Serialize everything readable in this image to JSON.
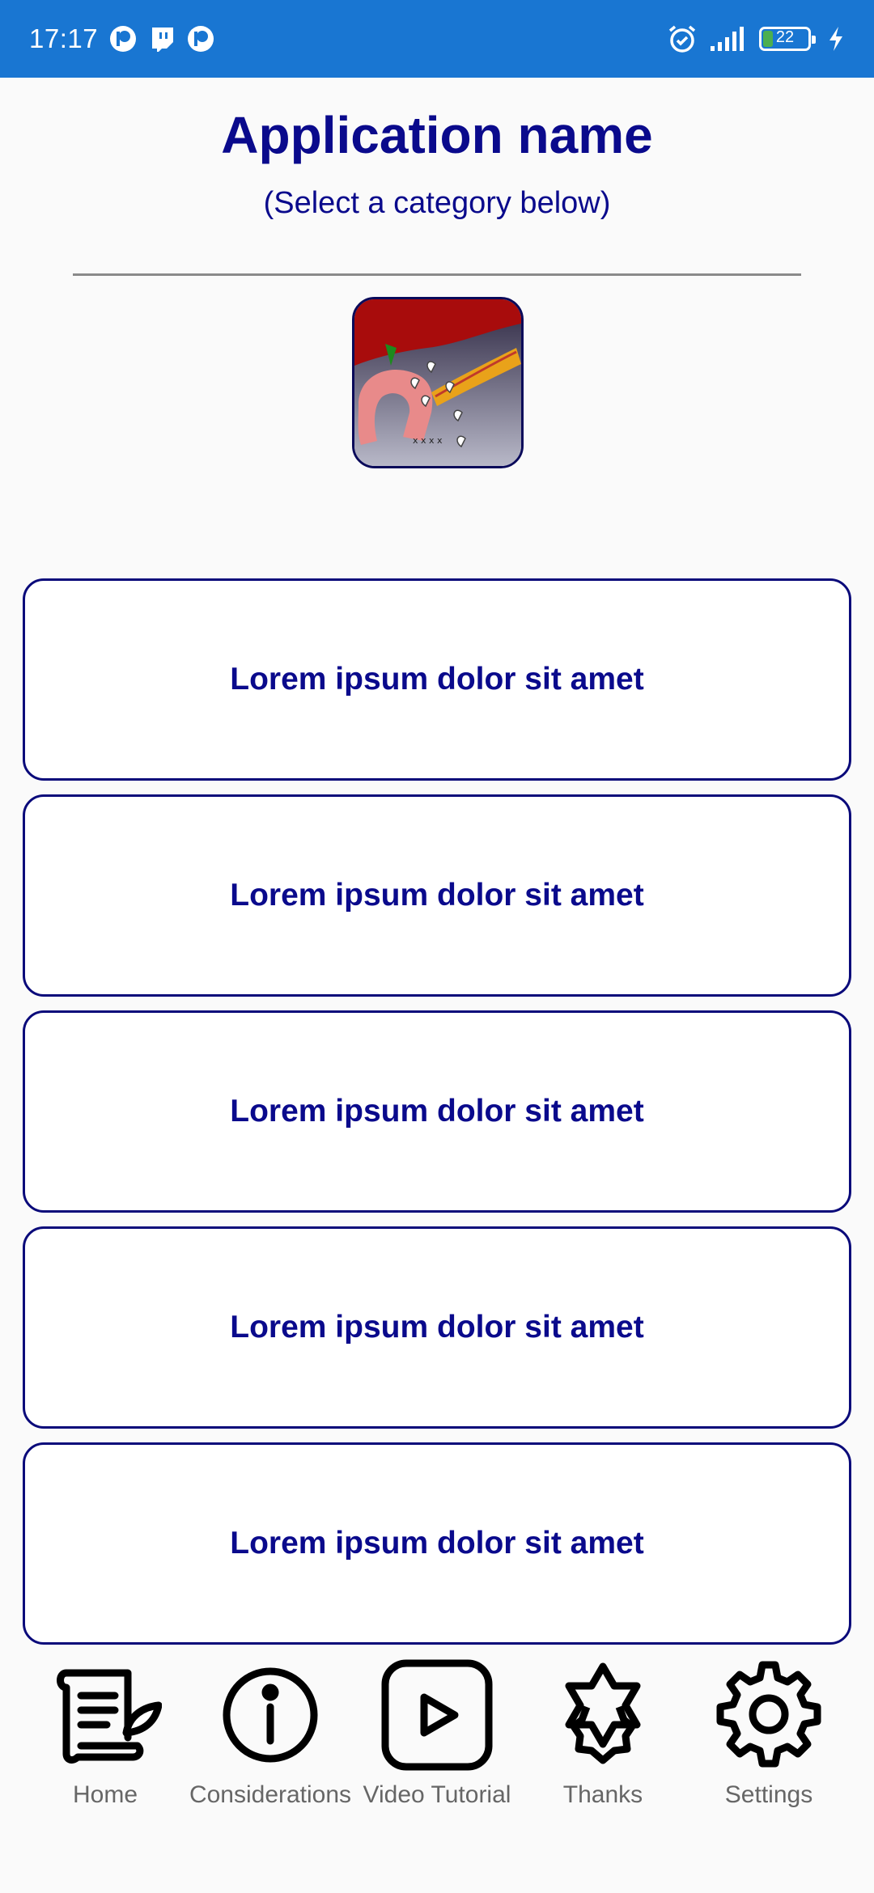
{
  "status_bar": {
    "time": "17:17",
    "battery": "22",
    "notification_icons": [
      "patreon-icon",
      "twitch-icon",
      "patreon-icon"
    ],
    "system_icons": [
      "alarm-icon",
      "signal-icon",
      "battery-icon",
      "charging-icon"
    ]
  },
  "header": {
    "title": "Application name",
    "subtitle": "(Select a category below)"
  },
  "categories": [
    {
      "label": "Lorem ipsum dolor sit amet"
    },
    {
      "label": "Lorem ipsum dolor sit amet"
    },
    {
      "label": "Lorem ipsum dolor sit amet"
    },
    {
      "label": "Lorem ipsum dolor sit amet"
    },
    {
      "label": "Lorem ipsum dolor sit amet"
    }
  ],
  "bottom_nav": [
    {
      "label": "Home",
      "icon": "scroll-icon"
    },
    {
      "label": "Considerations",
      "icon": "info-icon"
    },
    {
      "label": "Video Tutorial",
      "icon": "play-icon"
    },
    {
      "label": "Thanks",
      "icon": "badge-icon"
    },
    {
      "label": "Settings",
      "icon": "gear-icon"
    }
  ],
  "colors": {
    "status_bar": "#1976d2",
    "accent_text": "#0a0a8c",
    "background": "#fafafa",
    "nav_label": "#666666"
  }
}
